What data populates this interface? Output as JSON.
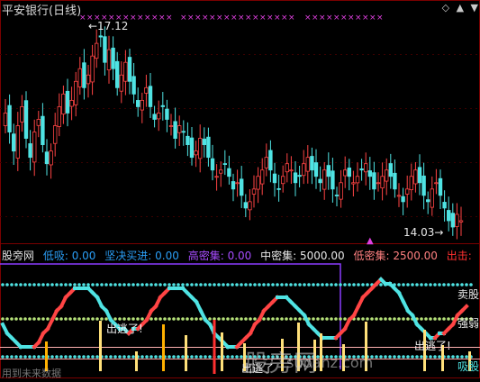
{
  "title": "平安银行(日线)",
  "window_buttons": [
    "◇",
    "▲",
    "▼"
  ],
  "price_labels": {
    "high": "17.12",
    "low": "14.03"
  },
  "indicator": {
    "name": "股旁网",
    "items": [
      {
        "label": "低吸:",
        "value": "0.00",
        "color": "#2a9df4"
      },
      {
        "label": "坚决买进:",
        "value": "0.00",
        "color": "#2a9df4"
      },
      {
        "label": "高密集:",
        "value": "0.00",
        "color": "#a74cff"
      },
      {
        "label": "中密集:",
        "value": "5000.00",
        "color": "#e8e8e8"
      },
      {
        "label": "低密集:",
        "value": "2500.00",
        "color": "#ff8080"
      },
      {
        "label": "出击:",
        "value": "",
        "color": "#ff3030"
      }
    ]
  },
  "right_labels": {
    "top": "卖股",
    "mid": "强弱",
    "bottom": "吸股"
  },
  "annotations": [
    "出逃了!",
    "出逃了!",
    "出逃了"
  ],
  "watermark": {
    "main": "股旁网",
    "url": "supanz.com"
  },
  "bottom_left": "用到未来数据",
  "colors": {
    "up": "#ff4444",
    "down": "#4fe3e3",
    "lilac": "#e040e0",
    "grid": "#7a0000"
  },
  "chart_data": {
    "type": "candlestick",
    "title": "平安银行(日线)",
    "annotated_high": 17.12,
    "annotated_low": 14.03,
    "series_note": "approximate daily OHLC, price descending from ~17.1 to ~14.0"
  }
}
